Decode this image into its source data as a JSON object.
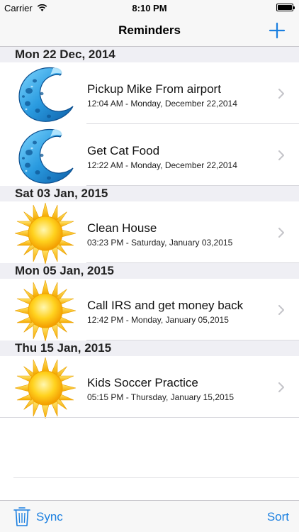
{
  "status_bar": {
    "carrier": "Carrier",
    "time": "8:10 PM",
    "battery_level": 1.0
  },
  "nav_bar": {
    "title": "Reminders",
    "add_icon": "plus-icon"
  },
  "sections": [
    {
      "header": "Mon 22 Dec, 2014",
      "items": [
        {
          "title": "Pickup Mike From airport",
          "subtitle": "12:04 AM - Monday, December 22,2014",
          "icon": "moon-icon"
        },
        {
          "title": "Get Cat Food",
          "subtitle": "12:22 AM - Monday, December 22,2014",
          "icon": "moon-icon"
        }
      ]
    },
    {
      "header": "Sat 03 Jan, 2015",
      "items": [
        {
          "title": "Clean House",
          "subtitle": "03:23 PM - Saturday, January 03,2015",
          "icon": "sun-icon"
        }
      ]
    },
    {
      "header": "Mon 05 Jan, 2015",
      "items": [
        {
          "title": "Call IRS and get money back",
          "subtitle": "12:42 PM - Monday, January 05,2015",
          "icon": "sun-icon"
        }
      ]
    },
    {
      "header": "Thu 15 Jan, 2015",
      "items": [
        {
          "title": "Kids Soccer Practice",
          "subtitle": "05:15 PM - Thursday, January 15,2015",
          "icon": "sun-icon"
        }
      ]
    }
  ],
  "toolbar": {
    "sync_label": "Sync",
    "sort_label": "Sort",
    "trash_icon": "trash-icon"
  },
  "colors": {
    "accent": "#1a7fe0",
    "section_bg": "#efeff4",
    "bar_bg": "#f7f7f7"
  }
}
